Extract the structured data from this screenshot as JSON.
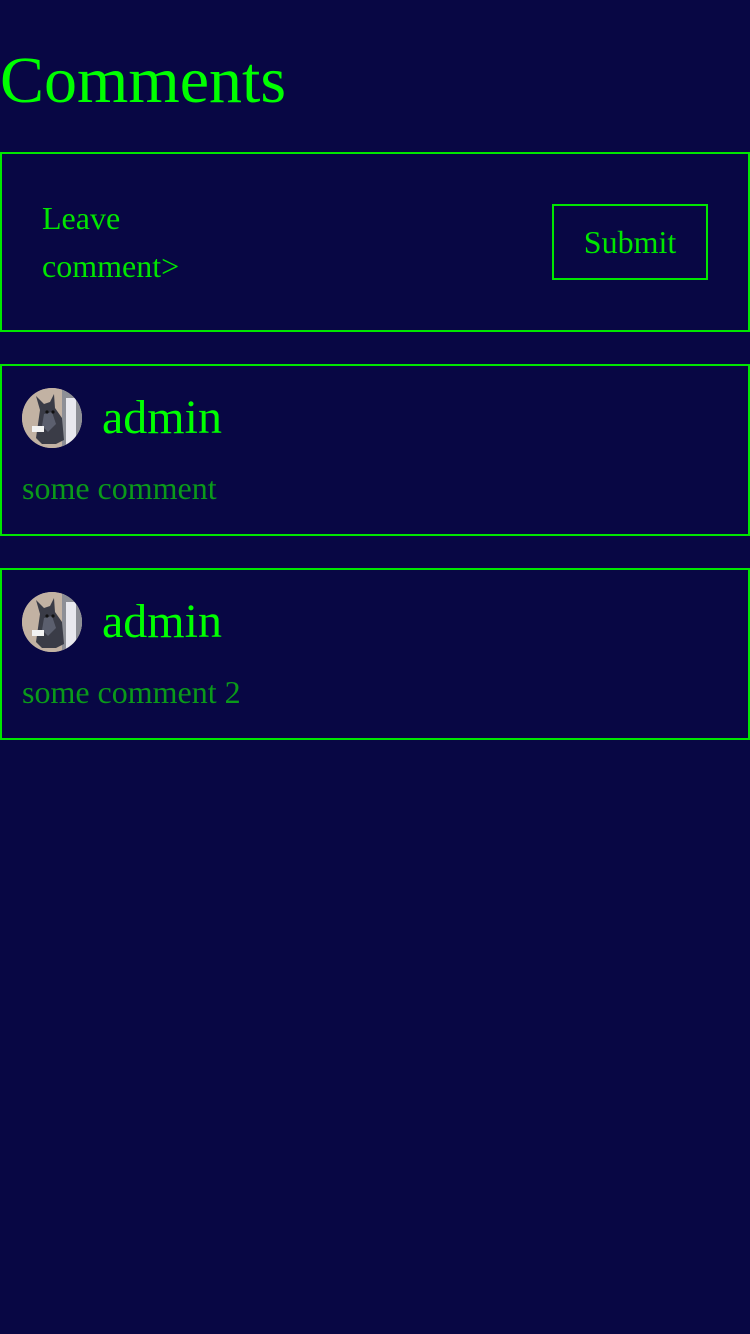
{
  "header": {
    "title": "Comments"
  },
  "composer": {
    "prompt": "Leave comment>",
    "submit_label": "Submit"
  },
  "comments": [
    {
      "author": "admin",
      "text": "some comment",
      "avatar_icon": "dog-photo-avatar"
    },
    {
      "author": "admin",
      "text": "some comment 2",
      "avatar_icon": "dog-photo-avatar"
    }
  ],
  "colors": {
    "background": "#080744",
    "accent": "#00ff00",
    "border": "#00e600",
    "comment_text": "#0a9a1a"
  }
}
